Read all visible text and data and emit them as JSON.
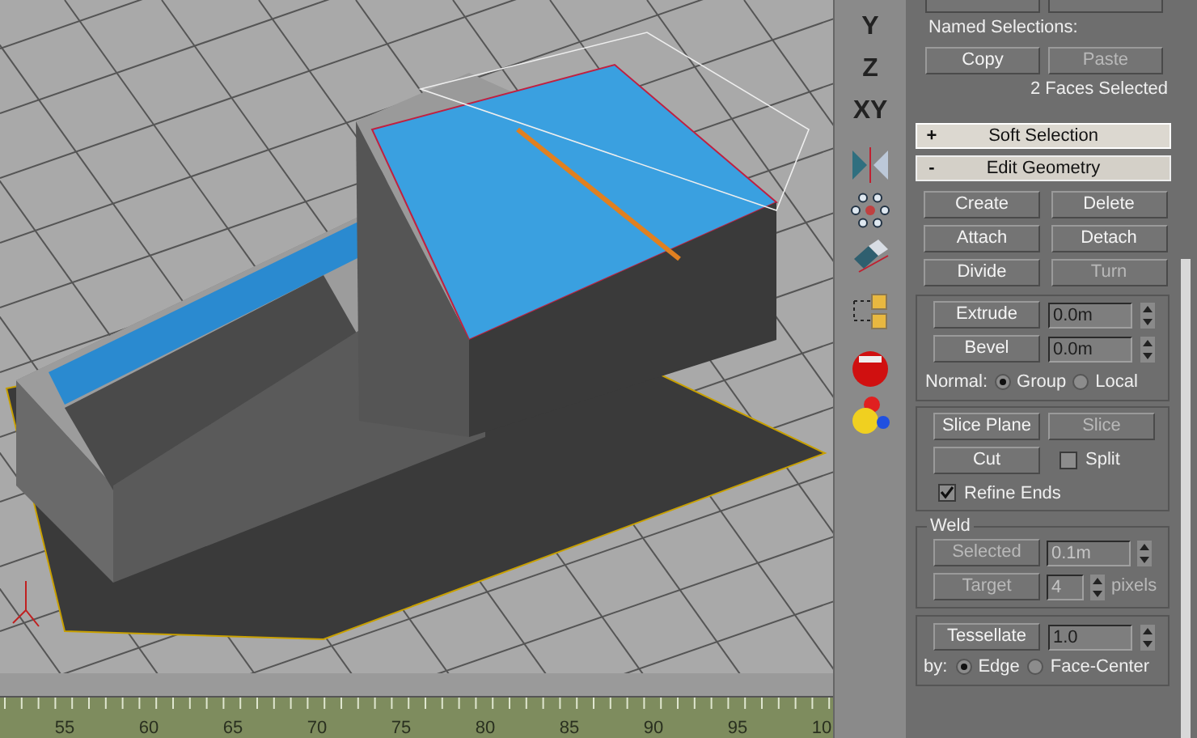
{
  "axis_buttons": [
    {
      "label": "Y"
    },
    {
      "label": "Z"
    },
    {
      "label": "XY"
    }
  ],
  "named_selections": {
    "label": "Named Selections:",
    "buttons": [
      {
        "label": "Copy",
        "disabled": false
      },
      {
        "label": "Paste",
        "disabled": true
      }
    ],
    "status": "2 Faces Selected"
  },
  "rollouts": [
    {
      "label": "Soft Selection",
      "sign": "+",
      "expanded": false
    },
    {
      "label": "Edit Geometry",
      "sign": "-",
      "expanded": true
    }
  ],
  "geometry_buttons": [
    {
      "label": "Create",
      "disabled": false
    },
    {
      "label": "Delete",
      "disabled": false
    },
    {
      "label": "Attach",
      "disabled": false
    },
    {
      "label": "Detach",
      "disabled": false
    },
    {
      "label": "Divide",
      "disabled": false
    },
    {
      "label": "Turn",
      "disabled": true
    }
  ],
  "spinners": [
    {
      "label": "Extrude",
      "value": "0.0m"
    },
    {
      "label": "Bevel",
      "value": "0.0m"
    }
  ],
  "normal": {
    "label": "Normal:",
    "options": [
      {
        "label": "Group",
        "selected": true
      },
      {
        "label": "Local",
        "selected": false
      }
    ]
  },
  "slice_buttons": [
    {
      "label": "Slice Plane",
      "disabled": false
    },
    {
      "label": "Slice",
      "disabled": true
    }
  ],
  "cut_button": {
    "label": "Cut",
    "disabled": false
  },
  "checkboxes": [
    {
      "label": "Split",
      "checked": false
    },
    {
      "label": "Refine Ends",
      "checked": true
    }
  ],
  "weld": {
    "title": "Weld",
    "rows": [
      {
        "label": "Selected",
        "value": "0.1m",
        "disabled": true
      },
      {
        "label": "Target",
        "value": "4",
        "unit": "pixels",
        "disabled": true
      }
    ]
  },
  "tessellate": {
    "label": "Tessellate",
    "value": "1.0",
    "by_label": "by:",
    "options": [
      {
        "label": "Edge",
        "selected": true
      },
      {
        "label": "Face-Center",
        "selected": false
      }
    ]
  },
  "timeline": {
    "ticks": [
      "55",
      "60",
      "65",
      "70",
      "75",
      "80",
      "85",
      "90",
      "95",
      "10"
    ]
  }
}
